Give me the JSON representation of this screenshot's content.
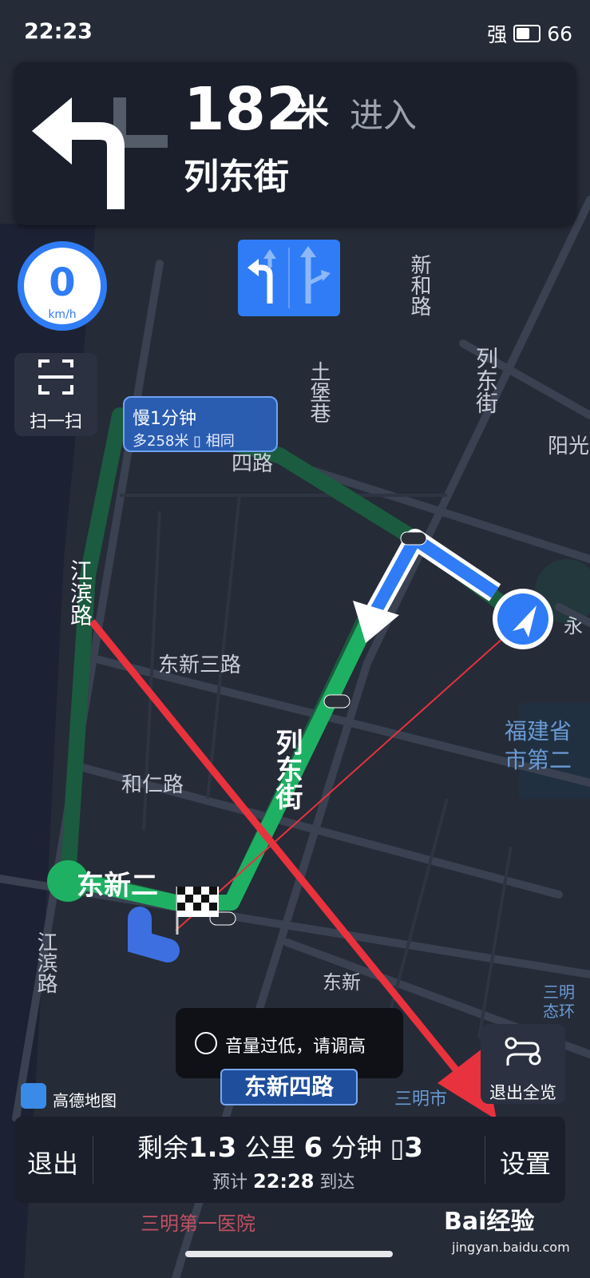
{
  "status_bar": {
    "time": "22:23",
    "signal_label": "强",
    "battery": "66"
  },
  "navigation": {
    "distance_value": "182",
    "distance_unit": "米",
    "action": "进入",
    "street": "列东街"
  },
  "speed": {
    "value": "0",
    "unit": "km/h"
  },
  "scan": {
    "label": "扫一扫"
  },
  "route_bubble": {
    "line1": "慢1分钟",
    "line2": "多258米",
    "line2_suffix": "相同"
  },
  "map_labels": {
    "xinhe_road": "新和路",
    "tubao_lane": "土堡巷",
    "liedong_street_top": "列东街",
    "yangguang": "阳光",
    "dongxin_si_partial": "四路",
    "jiangbin_road_top": "江滨路",
    "dongxin_san": "东新三路",
    "liedong_street_route": "列东街",
    "heren_road": "和仁路",
    "dongxin_er": "东新二",
    "fujian": "福建省",
    "shi_di_er": "市第二",
    "jiangbin_road_bottom": "江滨路",
    "dongxin_partial": "东新",
    "sanming_shi": "三明市",
    "sanming_hospital": "三明第一医院",
    "sanming_eco": "三明",
    "eco_partial": "态环",
    "yong": "永"
  },
  "toast": {
    "text": "音量过低，请调高"
  },
  "exit_overview": {
    "label": "退出全览"
  },
  "brand": {
    "name": "高德地图"
  },
  "road_chip": {
    "label": "东新四路"
  },
  "bottom_bar": {
    "exit_label": "退出",
    "settings_label": "设置",
    "remaining_prefix": "剩余",
    "remaining_distance": "1.3",
    "distance_unit": "公里",
    "remaining_time": "6",
    "time_unit": "分钟",
    "traffic_lights": "3",
    "eta_prefix": "预计",
    "eta_time": "22:28",
    "eta_suffix": "到达"
  },
  "watermark": {
    "text": "Bai经验",
    "url": "jingyan.baidu.com"
  },
  "colors": {
    "accent": "#2f7cf6",
    "route_green": "#1fb163",
    "arrow_red": "#e8323e"
  }
}
